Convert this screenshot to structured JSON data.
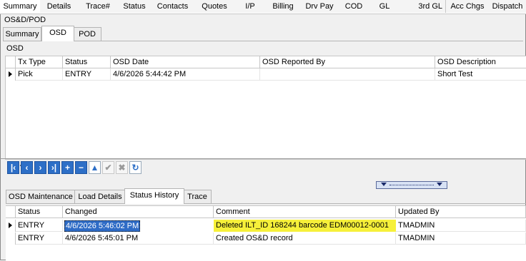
{
  "top_tabs": [
    "Summary",
    "Details",
    "Trace#",
    "Status",
    "Contacts",
    "Quotes",
    "I/P",
    "Billing",
    "Drv Pay",
    "COD",
    "GL",
    "3rd GL",
    "Acc Chgs",
    "Dispatch"
  ],
  "section_label": "OS&D/POD",
  "sub_tabs": [
    "Summary",
    "OSD",
    "POD"
  ],
  "osd_group_title": "OSD",
  "osd_grid": {
    "headers": [
      "Tx Type",
      "Status",
      "OSD Date",
      "OSD Reported By",
      "OSD Description"
    ],
    "rows": [
      {
        "tx_type": "Pick",
        "status": "ENTRY",
        "osd_date": "4/6/2026 5:44:42 PM",
        "reported_by": "",
        "description": "Short Test"
      }
    ]
  },
  "navigator": [
    "first-icon",
    "prev-icon",
    "next-icon",
    "last-icon",
    "add-icon",
    "delete-icon",
    "edit-icon",
    "post-icon",
    "cancel-icon",
    "refresh-icon"
  ],
  "bottom_tabs": [
    "OSD Maintenance",
    "Load Details",
    "Status History",
    "Trace"
  ],
  "history_grid": {
    "headers": [
      "Status",
      "Changed",
      "Comment",
      "Updated By"
    ],
    "rows": [
      {
        "status": "ENTRY",
        "changed": "4/6/2026 5:46:02 PM",
        "comment": "Deleted ILT_ID 168244 barcode EDM00012-0001",
        "updated_by": "TMADMIN"
      },
      {
        "status": "ENTRY",
        "changed": "4/6/2026 5:45:01 PM",
        "comment": "Created OS&D record",
        "updated_by": "TMADMIN"
      }
    ]
  },
  "colors": {
    "selection": "#2f6cc6",
    "highlight": "#f6f03a",
    "navigator_blue": "#2d6fc7"
  }
}
